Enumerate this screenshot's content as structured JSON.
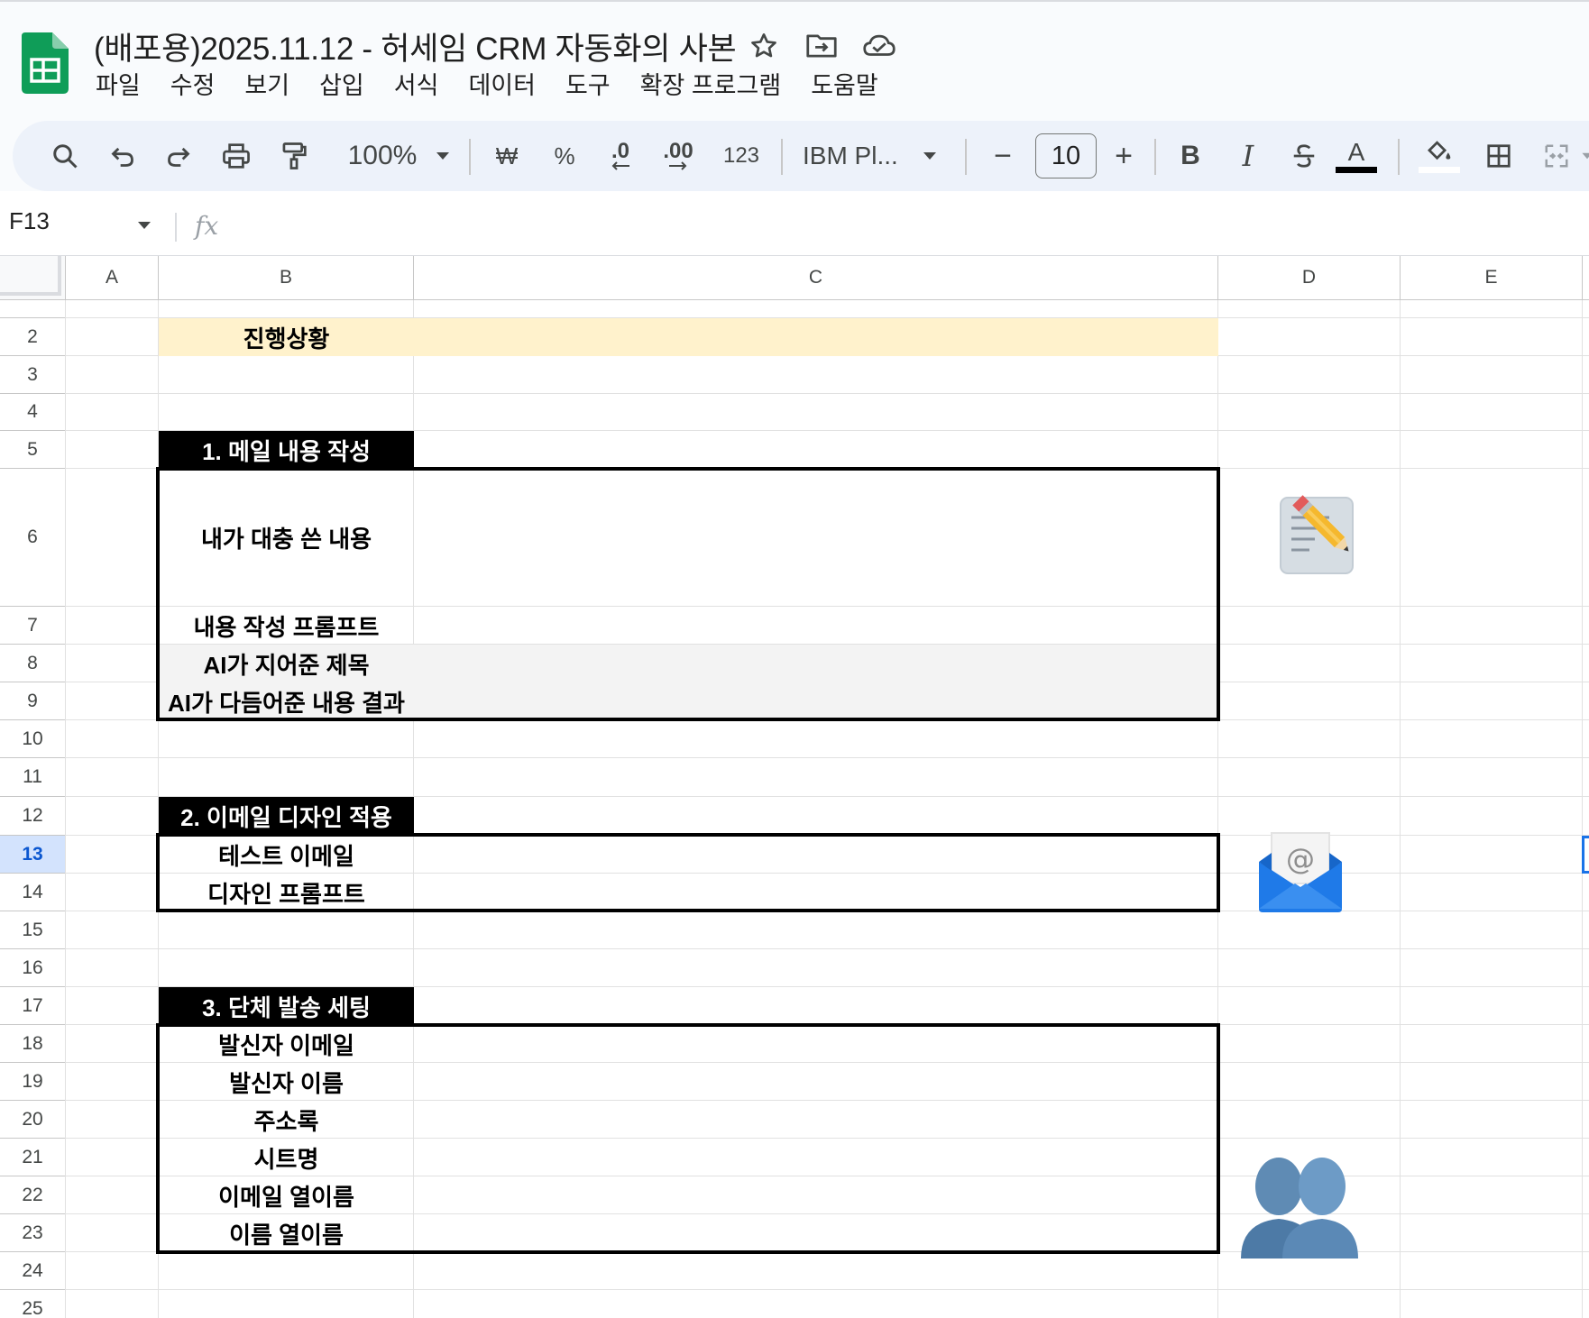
{
  "app": {
    "doc_title": "(배포용)2025.11.12 - 허세임 CRM 자동화의 사본",
    "logo_icon": "google-sheets-icon",
    "title_icons": [
      "star-icon",
      "move-to-folder-icon",
      "cloud-saved-icon"
    ]
  },
  "menu": [
    "파일",
    "수정",
    "보기",
    "삽입",
    "서식",
    "데이터",
    "도구",
    "확장 프로그램",
    "도움말"
  ],
  "toolbar": {
    "zoom": "100%",
    "currency": "₩",
    "percent": "%",
    "decimal_decrease": ".0",
    "decimal_increase": ".00",
    "number_format": "123",
    "font": "IBM Pl...",
    "font_size": "10",
    "minus": "−",
    "plus": "+",
    "bold": "B",
    "italic": "I",
    "text_color_label": "A"
  },
  "formula_bar": {
    "cell_ref": "F13",
    "fx": "fx",
    "value": ""
  },
  "grid": {
    "columns": [
      "A",
      "B",
      "C",
      "D",
      "E"
    ],
    "rows": [
      "2",
      "3",
      "4",
      "5",
      "6",
      "7",
      "8",
      "9",
      "10",
      "11",
      "12",
      "13",
      "14",
      "15",
      "16",
      "17",
      "18",
      "19",
      "20",
      "21",
      "22",
      "23",
      "24",
      "25"
    ],
    "selected_row": "13"
  },
  "cells": {
    "progress": "진행상황",
    "section1": {
      "title": "1. 메일 내용 작성",
      "rows": [
        "내가 대충 쓴 내용",
        "내용 작성 프롬프트",
        "AI가 지어준 제목",
        "AI가 다듬어준 내용 결과"
      ]
    },
    "section2": {
      "title": "2. 이메일 디자인 적용",
      "rows": [
        "테스트 이메일",
        "디자인 프롬프트"
      ]
    },
    "section3": {
      "title": "3. 단체 발송 세팅",
      "rows": [
        "발신자 이메일",
        "발신자 이름",
        "주소록",
        "시트명",
        "이메일 열이름",
        "이름 열이름"
      ]
    }
  },
  "images": [
    "memo-pencil-icon",
    "envelope-at-icon",
    "people-silhouette-icon"
  ],
  "colors": {
    "progress_fill": "#fff2cc",
    "gray_fill": "#f3f3f3",
    "section_tag": "#000000",
    "selected_row": "#d3e3fd",
    "sheets_green": "#0f9d58"
  }
}
